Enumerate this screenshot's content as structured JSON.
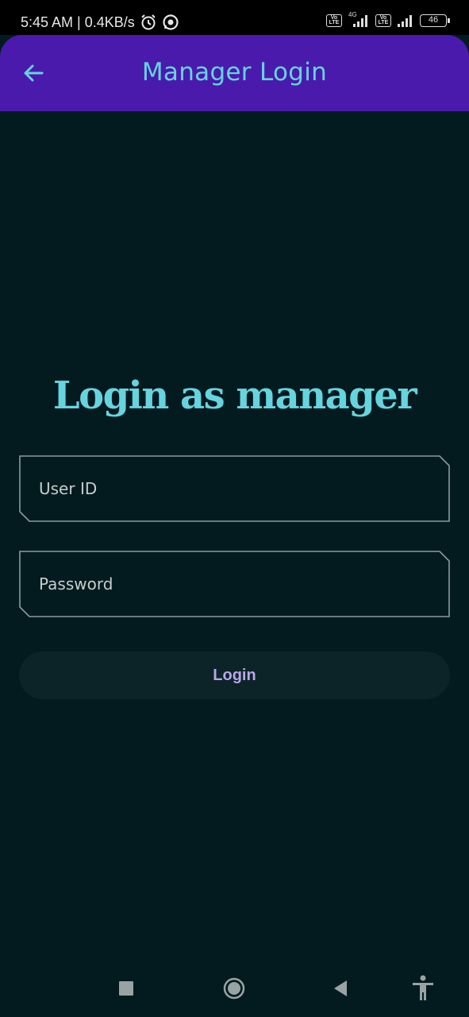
{
  "status_bar": {
    "time_speed": "5:45 AM | 0.4KB/s",
    "network_type": "4G",
    "volte_label": "Vo LTE",
    "battery": "46",
    "icons": [
      "alarm-icon",
      "whatsapp-icon",
      "volte-icon",
      "signal-icon",
      "battery-icon"
    ]
  },
  "app_bar": {
    "title": "Manager Login",
    "back_icon": "arrow-left-icon"
  },
  "main": {
    "heading": "Login as manager",
    "user_id": {
      "placeholder": "User ID",
      "value": ""
    },
    "password": {
      "placeholder": "Password",
      "value": ""
    },
    "login_label": "Login"
  },
  "nav_bar": {
    "icons": [
      "recents-icon",
      "home-icon",
      "back-icon",
      "accessibility-icon"
    ]
  },
  "colors": {
    "background": "#031b1f",
    "app_bar": "#4a1aad",
    "accent": "#66d4df",
    "button_bg": "#0c2327",
    "button_text": "#b8a6e8"
  }
}
